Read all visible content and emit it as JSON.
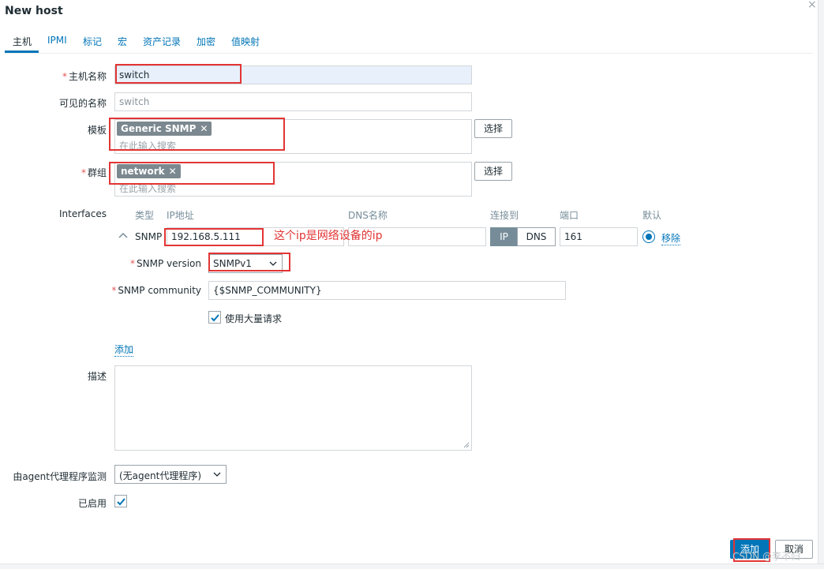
{
  "dialog": {
    "title": "New host",
    "close_glyph": "×"
  },
  "tabs": [
    {
      "label": "主机",
      "active": true
    },
    {
      "label": "IPMI"
    },
    {
      "label": "标记"
    },
    {
      "label": "宏"
    },
    {
      "label": "资产记录"
    },
    {
      "label": "加密"
    },
    {
      "label": "值映射"
    }
  ],
  "form": {
    "required_mark": "*",
    "hostname": {
      "label": "主机名称",
      "value": "switch"
    },
    "visible_name": {
      "label": "可见的名称",
      "placeholder": "switch"
    },
    "templates": {
      "label": "模板",
      "chips": [
        "Generic SNMP"
      ],
      "placeholder": "在此输入搜索",
      "select_button": "选择"
    },
    "groups": {
      "label": "群组",
      "chips": [
        "network"
      ],
      "placeholder": "在此输入搜索",
      "select_button": "选择"
    },
    "interfaces": {
      "label": "Interfaces",
      "headers": {
        "type": "类型",
        "ip": "IP地址",
        "dns": "DNS名称",
        "connect": "连接到",
        "port": "端口",
        "default": "默认"
      },
      "row": {
        "type": "SNMP",
        "ip": "192.168.5.111",
        "dns": "",
        "connect_options": [
          "IP",
          "DNS"
        ],
        "connect_selected": "IP",
        "port": "161",
        "remove": "移除"
      },
      "snmp_version": {
        "label": "SNMP version",
        "value": "SNMPv1"
      },
      "snmp_community": {
        "label": "SNMP community",
        "value": "{$SNMP_COMMUNITY}"
      },
      "bulk": {
        "label": "使用大量请求",
        "checked": true
      },
      "add_link": "添加"
    },
    "description": {
      "label": "描述",
      "value": ""
    },
    "proxy": {
      "label": "由agent代理程序监测",
      "value": "(无agent代理程序)"
    },
    "enabled": {
      "label": "已启用",
      "checked": true
    }
  },
  "annotation": {
    "text": "这个ip是网络设备的ip",
    "color": "#e23535"
  },
  "footer": {
    "add_button": "添加",
    "cancel_button": "取消"
  },
  "watermark": "CSDN @李不归",
  "colors": {
    "accent": "#0275b8",
    "required": "#e45959",
    "annotation_box": "#e23535"
  },
  "icons": {
    "close": "close-icon",
    "collapse": "chevron-up-icon",
    "chip_remove": "close-icon",
    "dropdown": "chevron-down-icon",
    "check": "check-icon"
  }
}
